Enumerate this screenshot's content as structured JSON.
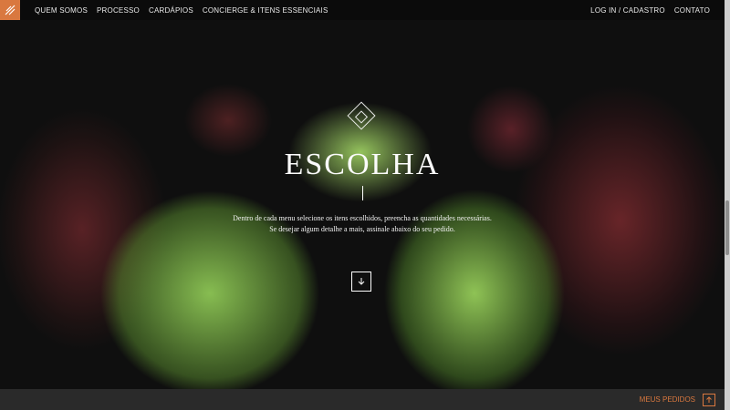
{
  "nav": {
    "items": [
      {
        "label": "QUEM SOMOS"
      },
      {
        "label": "PROCESSO"
      },
      {
        "label": "CARDÁPIOS"
      },
      {
        "label": "CONCIERGE & ITENS ESSENCIAIS"
      }
    ],
    "right": [
      {
        "label": "LOG IN / CADASTRO"
      },
      {
        "label": "CONTATO"
      }
    ]
  },
  "hero": {
    "title": "ESCOLHA",
    "description_1": "Dentro de cada menu selecione os itens escolhidos, preencha as quantidades necessárias.",
    "description_2": "Se desejar algum detalhe a mais, assinale abaixo do seu pedido."
  },
  "footer": {
    "label": "MEUS PEDIDOS"
  },
  "icons": {
    "logo": "brand-logo-icon",
    "diamond": "diamond-icon",
    "down": "down-arrow-icon",
    "up": "up-arrow-icon"
  },
  "colors": {
    "accent": "#d9783f",
    "footer": "#2a2a2a"
  }
}
